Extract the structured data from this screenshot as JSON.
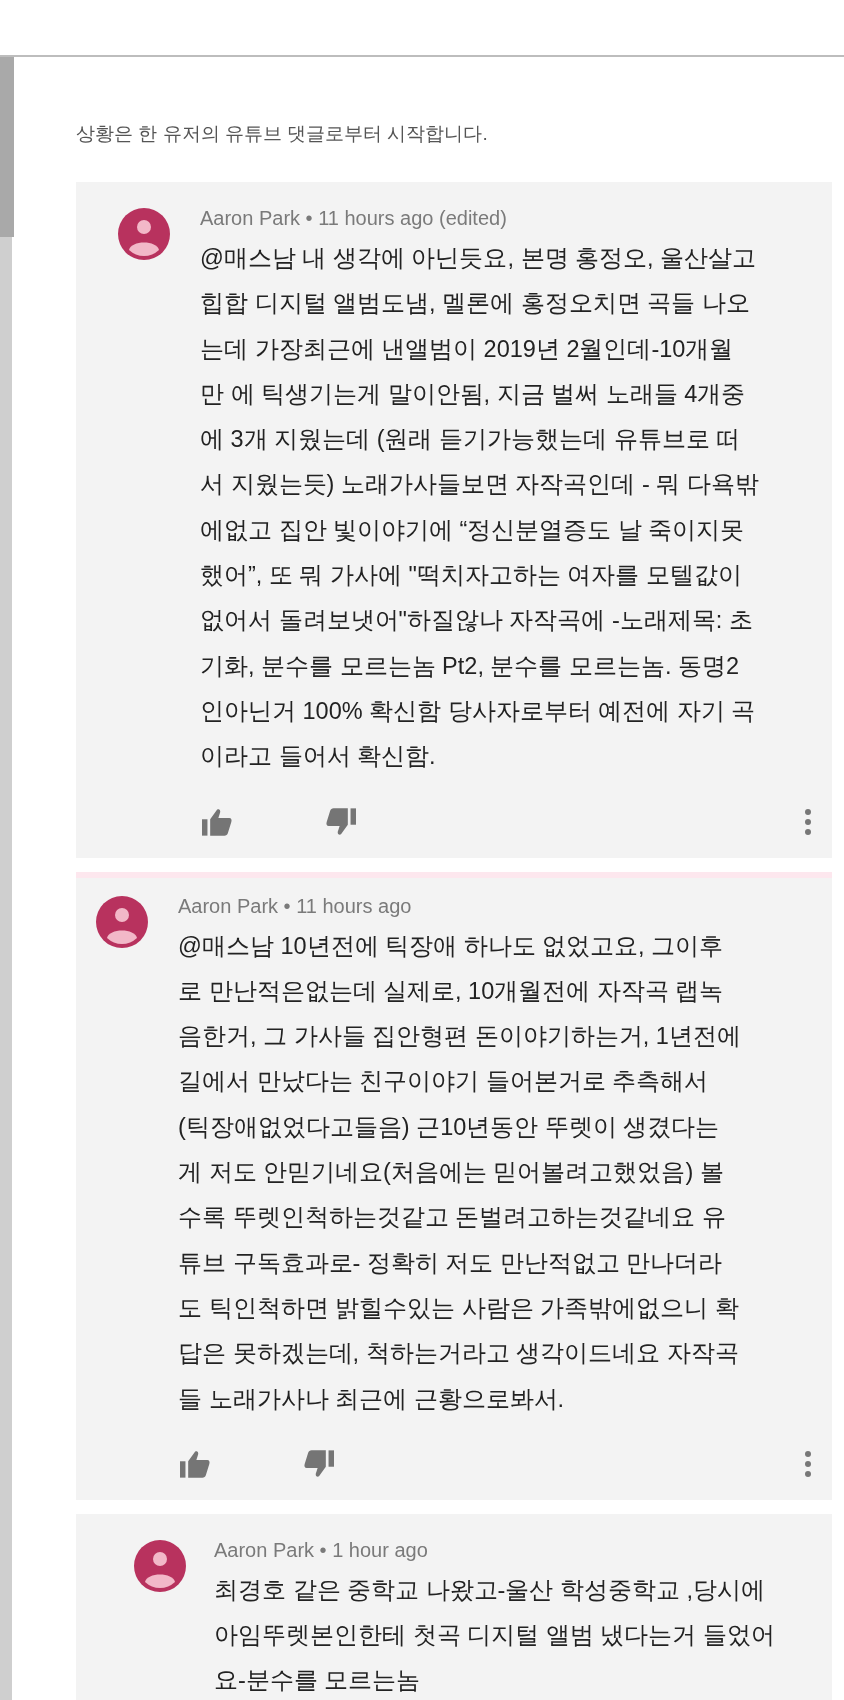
{
  "intro": "상황은 한 유저의 유튜브 댓글로부터 시작합니다.",
  "comments": [
    {
      "meta": "Aaron Park • 11 hours ago (edited)",
      "highlighted": false,
      "reply": false,
      "text": "@매스남 내 생각에 아닌듯요, 본명 홍정오, 울산살고\n힙합 디지털 앨범도냄, 멜론에 홍정오치면 곡들 나오\n는데 가장최근에 낸앨범이 2019년 2월인데-10개월\n만 에 틱생기는게 말이안됨, 지금 벌써 노래들 4개중\n에 3개 지웠는데 (원래 듣기가능했는데 유튜브로 떠\n서 지웠는듯) 노래가사들보면 자작곡인데 - 뭐 다욕밖\n에없고 집안 빛이야기에 “정신분열증도 날 죽이지못\n했어”, 또 뭐 가사에 \"떡치자고하는 여자를 모텔값이\n없어서 돌려보냇어\"하질않나 자작곡에 -노래제목: 초\n기화, 분수를 모르는놈 Pt2, 분수를 모르는놈. 동명2\n인아닌거 100% 확신함 당사자로부터 예전에 자기 곡\n이라고 들어서 확신함."
    },
    {
      "meta": "Aaron Park • 11 hours ago",
      "highlighted": true,
      "reply": false,
      "text": "@매스남 10년전에 틱장애 하나도 없었고요, 그이후\n로 만난적은없는데 실제로, 10개월전에 자작곡 랩녹\n음한거, 그 가사들 집안형편 돈이야기하는거, 1년전에\n길에서 만났다는 친구이야기 들어본거로 추측해서\n(틱장애없었다고들음) 근10년동안 뚜렛이 생겼다는\n게 저도 안믿기네요(처음에는 믿어볼려고했었음) 볼\n수록 뚜렛인척하는것같고 돈벌려고하는것같네요 유\n튜브 구독효과로- 정확히 저도 만난적없고 만나더라\n도 틱인척하면 밝힐수있는 사람은 가족밖에없으니 확\n답은 못하겠는데, 척하는거라고 생각이드네요 자작곡\n들 노래가사나 최근에 근황으로봐서."
    },
    {
      "meta": "Aaron Park • 1 hour ago",
      "highlighted": false,
      "reply": true,
      "text": "최경호 같은 중학교 나왔고-울산 학성중학교 ,당시에\n아임뚜렛본인한테 첫곡 디지털 앨범 냈다는거 들었어\n요-분수를 모르는놈"
    }
  ]
}
